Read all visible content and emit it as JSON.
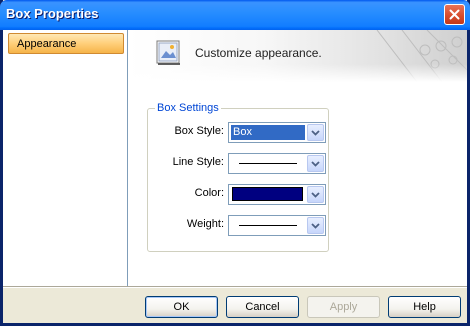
{
  "window": {
    "title": "Box Properties"
  },
  "sidebar": {
    "items": [
      {
        "label": "Appearance",
        "selected": true
      }
    ]
  },
  "header": {
    "text": "Customize appearance."
  },
  "box_settings": {
    "legend": "Box Settings",
    "box_style": {
      "label": "Box Style:",
      "value": "Box"
    },
    "line_style": {
      "label": "Line Style:"
    },
    "color": {
      "label": "Color:",
      "value_color": "#000080"
    },
    "weight": {
      "label": "Weight:"
    }
  },
  "buttons": {
    "ok": "OK",
    "cancel": "Cancel",
    "apply": "Apply",
    "help": "Help"
  },
  "colors": {
    "titlebar": "#0058ee",
    "sidebar_selected": "#ffcf7a",
    "group_legend": "#0046d5",
    "selection": "#316ac5"
  }
}
